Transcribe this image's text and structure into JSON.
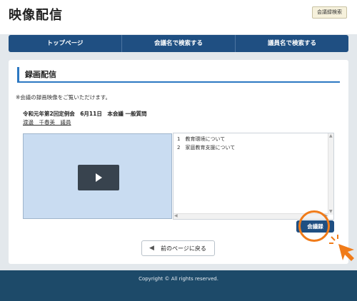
{
  "header": {
    "site_title": "映像配信",
    "minutes_search_label": "会議録検索"
  },
  "nav": {
    "items": [
      {
        "label": "トップページ"
      },
      {
        "label": "会議名で検索する"
      },
      {
        "label": "議員名で検索する"
      }
    ]
  },
  "main": {
    "section_title": "録画配信",
    "notice": "※会議の録画映像をご覧いただけます。",
    "meeting": "令和元年第2回定例会　6月11日　本会議 一般質問",
    "speaker": "渡邊　千春美　議員",
    "agenda": [
      "1　教育環境について",
      "2　家庭教育支援について"
    ],
    "minutes_button": "会議録",
    "back_button": "前のページに戻る"
  },
  "footer": {
    "copyright": "Copyright ©  All rights reserved."
  },
  "colors": {
    "nav_bg": "#1f4f82",
    "accent": "#2c78c2",
    "footer_bg": "#1d4a69",
    "highlight": "#f07b19"
  }
}
